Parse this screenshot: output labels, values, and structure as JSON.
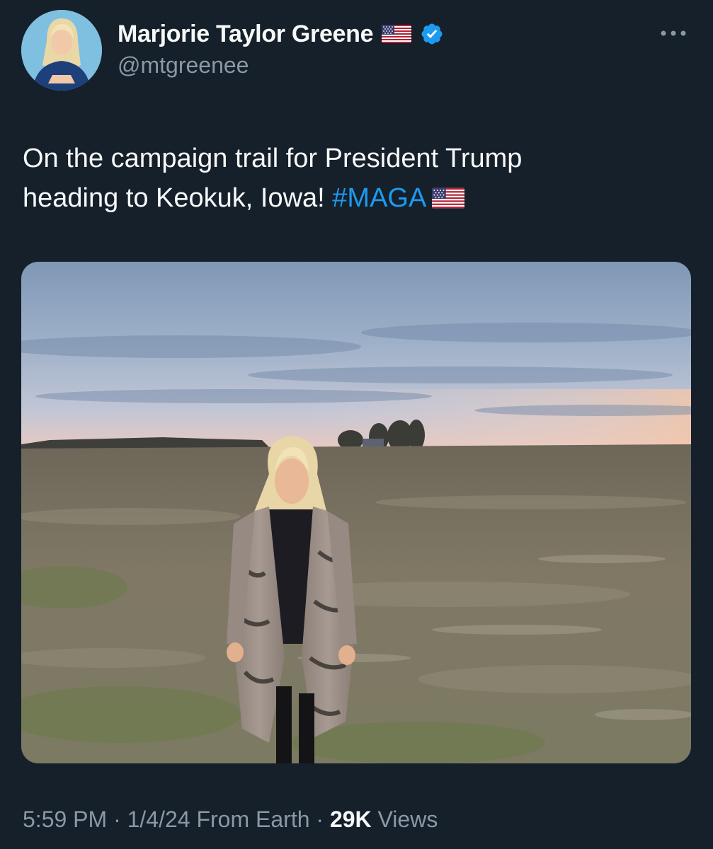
{
  "tweet": {
    "author": {
      "display_name": "Marjorie Taylor Greene",
      "handle": "@mtgreenee",
      "verified": true,
      "name_emoji": "flag-us-icon"
    },
    "text_line1": "On the campaign trail for President Trump",
    "text_line2_prefix": "heading to Keokuk, Iowa! ",
    "hashtag": "#MAGA",
    "text_emoji": "flag-us-icon",
    "media_alt": "photo",
    "timestamp": {
      "time": "5:59 PM",
      "separator1": " · ",
      "date": "1/4/24",
      "source": " From Earth",
      "separator2": " · ",
      "views_count": "29K",
      "views_label": " Views"
    }
  },
  "colors": {
    "background": "#15202b",
    "text": "#f7f9f9",
    "secondary_text": "#8b98a5",
    "accent": "#1d9bf0"
  }
}
